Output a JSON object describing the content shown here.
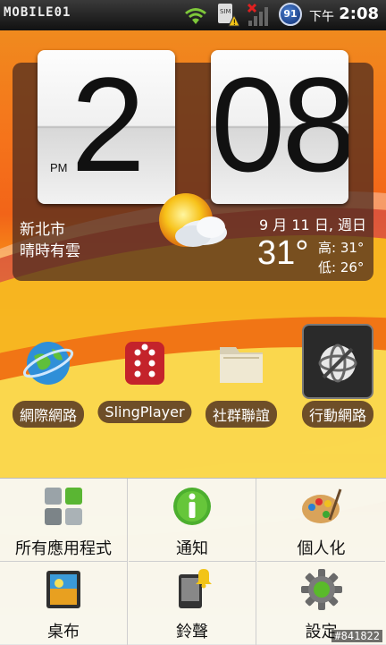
{
  "status_bar": {
    "logo_text": "MOBILE01",
    "battery_level": "91",
    "ampm": "下午",
    "time": "2:08"
  },
  "clock_widget": {
    "hour": "2",
    "minute": "08",
    "period": "PM",
    "location": "新北市",
    "condition": "晴時有雲",
    "date": "9 月 11 日, 週日",
    "temperature": "31°",
    "high": "高: 31°",
    "low": "低: 26°"
  },
  "shortcuts": [
    {
      "label": "網際網路",
      "icon": "globe-icon"
    },
    {
      "label": "SlingPlayer",
      "icon": "slingplayer-icon"
    },
    {
      "label": "社群聯誼",
      "icon": "folder-icon"
    },
    {
      "label": "行動網路",
      "icon": "mobile-network-icon"
    }
  ],
  "menu": [
    {
      "label": "所有應用程式",
      "icon": "apps-grid-icon"
    },
    {
      "label": "通知",
      "icon": "info-icon"
    },
    {
      "label": "個人化",
      "icon": "palette-icon"
    },
    {
      "label": "桌布",
      "icon": "wallpaper-icon"
    },
    {
      "label": "鈴聲",
      "icon": "ringtone-icon"
    },
    {
      "label": "設定",
      "icon": "gear-icon"
    }
  ],
  "watermark": "#841822",
  "colors": {
    "accent_orange": "#f26418",
    "accent_yellow": "#f8d238",
    "widget_bg": "#46281e"
  }
}
